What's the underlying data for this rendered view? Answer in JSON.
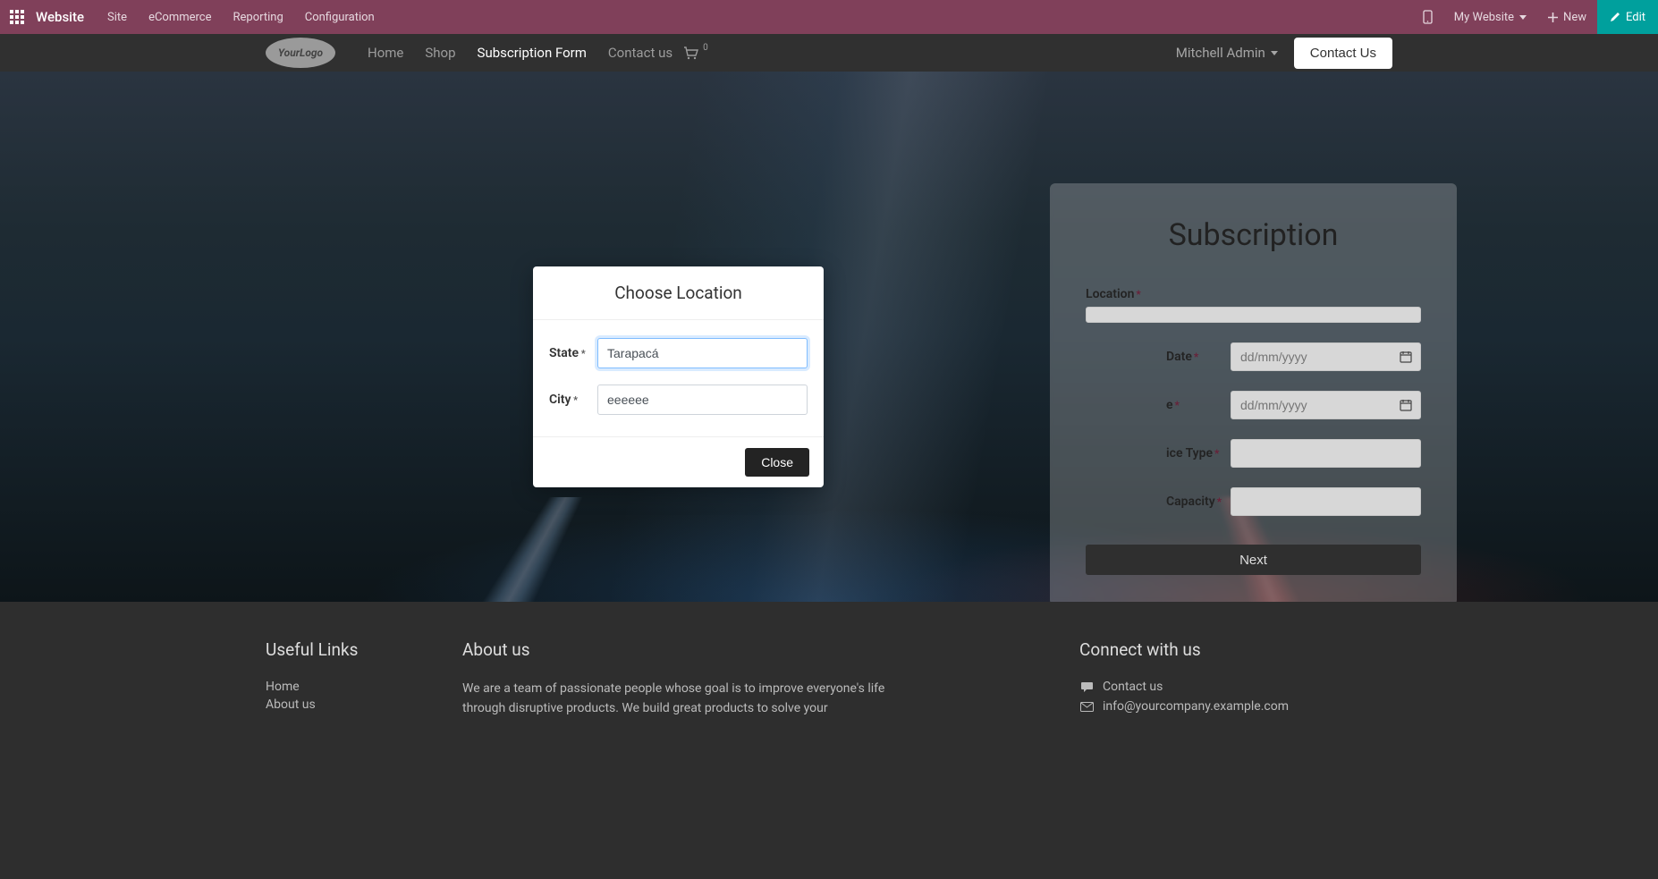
{
  "toolbar": {
    "app_name": "Website",
    "menus": [
      "Site",
      "eCommerce",
      "Reporting",
      "Configuration"
    ],
    "my_website": "My Website",
    "new_label": "New",
    "edit_label": "Edit"
  },
  "header": {
    "logo_text": "YourLogo",
    "nav": [
      {
        "label": "Home",
        "active": false
      },
      {
        "label": "Shop",
        "active": false
      },
      {
        "label": "Subscription Form",
        "active": true
      },
      {
        "label": "Contact us",
        "active": false
      }
    ],
    "cart_count": "0",
    "admin_name": "Mitchell Admin",
    "contact_label": "Contact Us"
  },
  "subscription": {
    "title": "Subscription",
    "location_label": "Location",
    "date_label": "Date",
    "type_label": "ice Type",
    "capacity_label": "Capacity",
    "date_placeholder": "dd/mm/yyyy",
    "next_label": "Next"
  },
  "modal": {
    "title": "Choose Location",
    "state_label": "State",
    "state_value": "Tarapacá",
    "city_label": "City",
    "city_value": "eeeeee",
    "close_label": "Close"
  },
  "footer": {
    "useful_heading": "Useful Links",
    "useful_links": [
      "Home",
      "About us"
    ],
    "about_heading": "About us",
    "about_text": "We are a team of passionate people whose goal is to improve everyone's life through disruptive products. We build great products to solve your",
    "connect_heading": "Connect with us",
    "connect_items": [
      {
        "icon": "chat",
        "text": "Contact us"
      },
      {
        "icon": "mail",
        "text": "info@yourcompany.example.com"
      }
    ]
  }
}
